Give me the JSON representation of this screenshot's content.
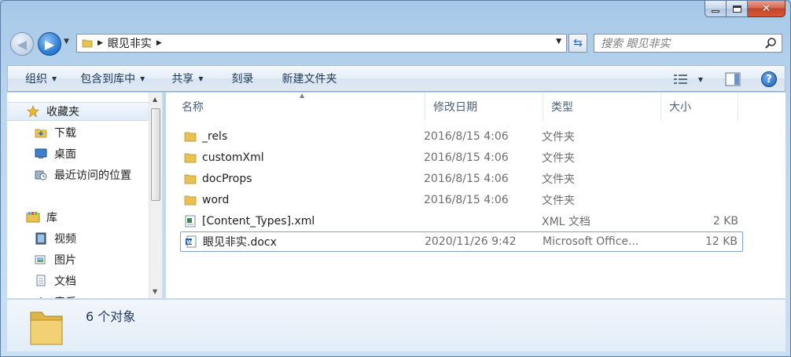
{
  "window": {
    "caption": {
      "minimize": "minimize",
      "maximize": "maximize",
      "close": "close"
    }
  },
  "address": {
    "path": "眼见非实",
    "search_placeholder": "搜索 眼见非实"
  },
  "toolbar": {
    "organize": "组织",
    "include_in_library": "包含到库中",
    "share": "共享",
    "burn": "刻录",
    "new_folder": "新建文件夹"
  },
  "nav": {
    "favorites_label": "收藏夹",
    "favorites": [
      {
        "label": "下载",
        "icon": "download-folder-icon"
      },
      {
        "label": "桌面",
        "icon": "desktop-icon"
      },
      {
        "label": "最近访问的位置",
        "icon": "recent-places-icon"
      }
    ],
    "libraries_label": "库",
    "libraries": [
      {
        "label": "视频",
        "icon": "videos-icon"
      },
      {
        "label": "图片",
        "icon": "pictures-icon"
      },
      {
        "label": "文档",
        "icon": "documents-icon"
      },
      {
        "label": "音乐",
        "icon": "music-icon"
      }
    ]
  },
  "columns": {
    "name": "名称",
    "date": "修改日期",
    "type": "类型",
    "size": "大小"
  },
  "files": [
    {
      "name": "_rels",
      "date": "2016/8/15 4:06",
      "type": "文件夹",
      "size": "",
      "icon": "folder-icon"
    },
    {
      "name": "customXml",
      "date": "2016/8/15 4:06",
      "type": "文件夹",
      "size": "",
      "icon": "folder-icon"
    },
    {
      "name": "docProps",
      "date": "2016/8/15 4:06",
      "type": "文件夹",
      "size": "",
      "icon": "folder-icon"
    },
    {
      "name": "word",
      "date": "2016/8/15 4:06",
      "type": "文件夹",
      "size": "",
      "icon": "folder-icon"
    },
    {
      "name": "[Content_Types].xml",
      "date": "",
      "type": "XML 文档",
      "size": "2 KB",
      "icon": "xml-file-icon"
    },
    {
      "name": "眼见非实.docx",
      "date": "2020/11/26 9:42",
      "type": "Microsoft Office...",
      "size": "12 KB",
      "icon": "word-doc-icon"
    }
  ],
  "status": {
    "item_count": "6 个对象"
  },
  "colors": {
    "accent": "#2f7fd3",
    "folder": "#e8c253",
    "selection_border": "#7da2ce"
  }
}
